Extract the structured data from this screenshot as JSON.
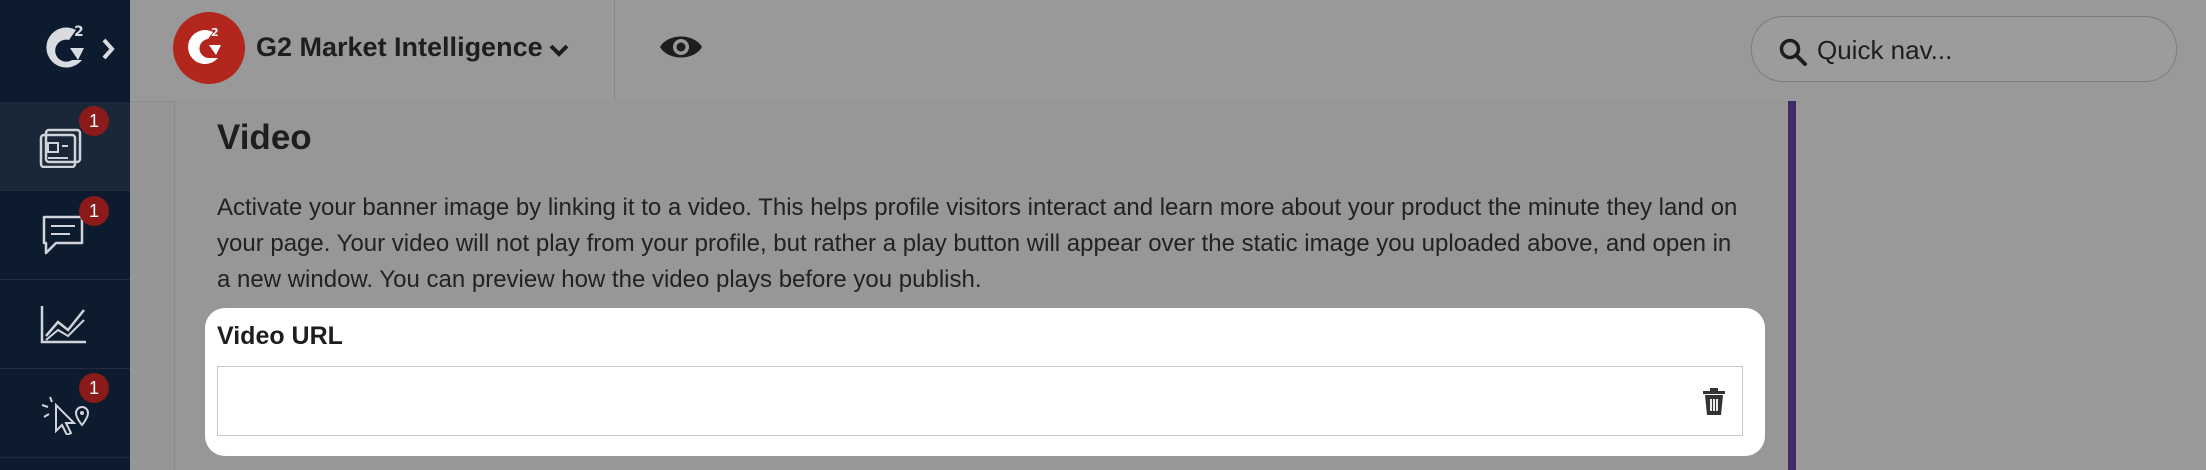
{
  "sidebar": {
    "logo_name": "g2-logo-icon",
    "items": [
      {
        "icon": "profile-pages-icon",
        "badge": "1"
      },
      {
        "icon": "chat-icon",
        "badge": "1"
      },
      {
        "icon": "analytics-chart-icon",
        "badge": ""
      },
      {
        "icon": "intent-cursor-icon",
        "badge": "1"
      }
    ]
  },
  "header": {
    "product_name": "G2 Market Intelligence",
    "search": {
      "placeholder": "Quick nav..."
    }
  },
  "main": {
    "section_title": "Video",
    "description": "Activate your banner image by linking it to a video. This helps profile visitors interact and learn more about your product the minute they land on your page. Your video will not play from your profile, but rather a play button will appear over the static image you uploaded above, and open in a new window. You can preview how the video plays before you publish.",
    "video_url": {
      "label": "Video URL",
      "value": ""
    }
  },
  "colors": {
    "sidebar_bg": "#0d1b2e",
    "badge": "#8b1a1a",
    "brand_red": "#b3261e",
    "accent_purple": "#3f2a6b"
  }
}
